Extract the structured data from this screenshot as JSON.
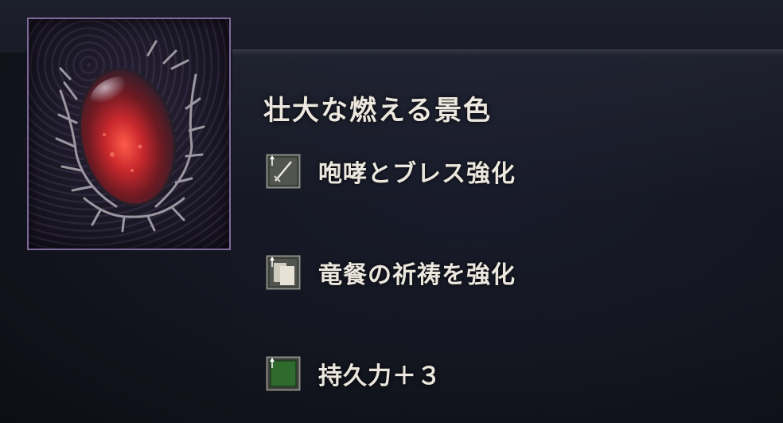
{
  "item": {
    "title": "壮大な燃える景色",
    "icon": "red-gem-in-thorns",
    "frame_color": "#7d6a99"
  },
  "effects": [
    {
      "label": "咆哮とブレス強化",
      "icon": "sword-up-icon"
    },
    {
      "label": "竜餐の祈祷を強化",
      "icon": "scroll-up-icon"
    },
    {
      "label": "持久力＋３",
      "icon": "green-square-up-icon"
    }
  ],
  "colors": {
    "text": "#ece8df",
    "background": "#13151f",
    "accent_red": "#c8282d",
    "stamina_green": "#2f6b2d"
  }
}
